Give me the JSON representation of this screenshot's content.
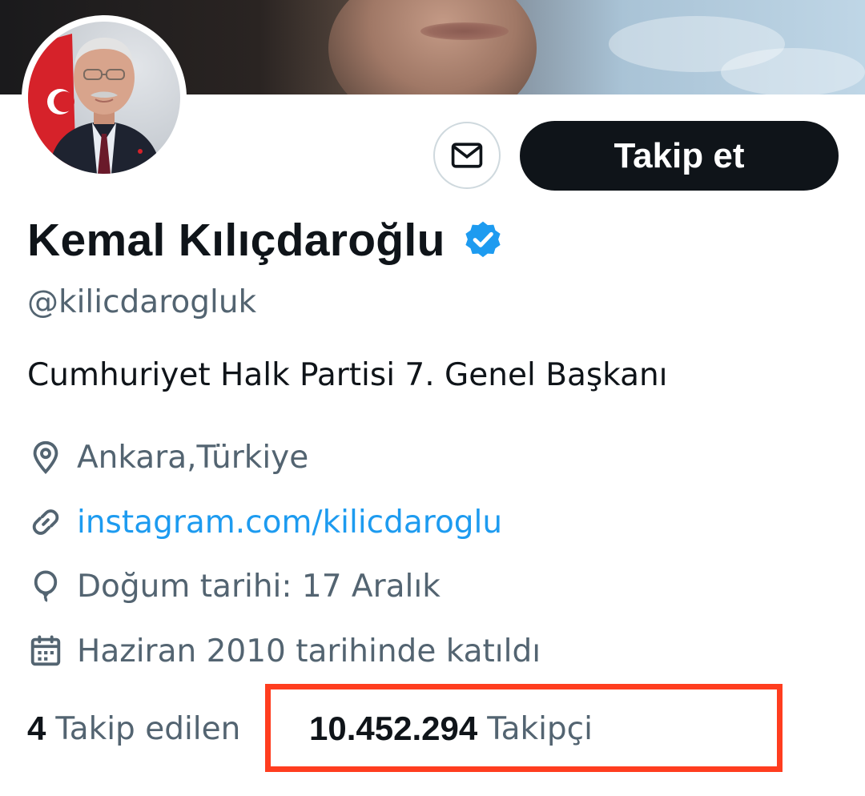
{
  "profile": {
    "name": "Kemal Kılıçdaroğlu",
    "handle": "@kilicdarogluk",
    "bio": "Cumhuriyet Halk Partisi 7. Genel Başkanı",
    "location": "Ankara,Türkiye",
    "website": "instagram.com/kilicdaroglu",
    "birthday": "Doğum tarihi: 17 Aralık",
    "joined": "Haziran 2010 tarihinde katıldı"
  },
  "actions": {
    "follow_label": "Takip et"
  },
  "stats": {
    "following_count": "4",
    "following_label": "Takip edilen",
    "followers_count": "10.452.294",
    "followers_label": "Takipçi"
  },
  "icons": {
    "message": "envelope-icon",
    "verified": "verified-badge-icon",
    "location": "location-pin-icon",
    "website": "link-icon",
    "birthday": "balloon-icon",
    "joined": "calendar-icon"
  },
  "colors": {
    "verified_blue": "#1d9bf0",
    "link_blue": "#1d9bf0",
    "follow_button": "#0f1419",
    "highlight_box": "#ff3d1f",
    "secondary_text": "#536471"
  }
}
